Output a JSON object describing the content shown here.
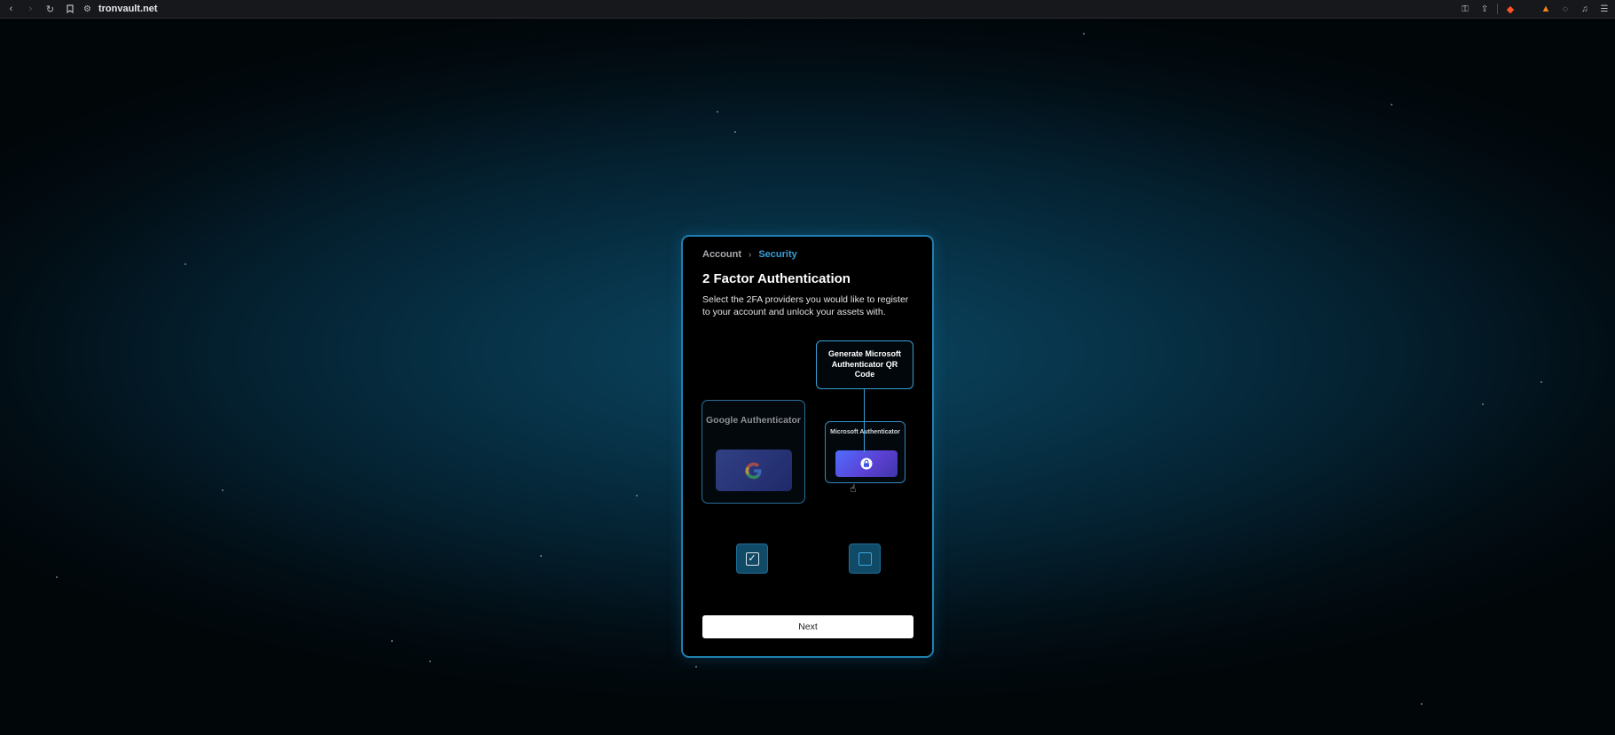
{
  "browser": {
    "url": "tronvault.net",
    "icons": [
      "back-icon",
      "forward-icon",
      "reload-icon",
      "bookmark-icon",
      "site-settings-icon",
      "key-icon",
      "share-icon",
      "brave-shield-icon",
      "metamask-icon",
      "chat-icon",
      "music-icon",
      "menu-icon"
    ]
  },
  "breadcrumb": {
    "items": [
      "Account",
      "Security"
    ],
    "separator": "›"
  },
  "page": {
    "title": "2 Factor Authentication",
    "description": "Select the 2FA providers you would like to register to your account and unlock your assets with."
  },
  "providers": [
    {
      "name": "Google Authenticator",
      "checked": true
    },
    {
      "name": "Microsoft Authenticator",
      "checked": false
    }
  ],
  "callout": "Generate Microsoft Authenticator QR Code",
  "next_label": "Next",
  "colors": {
    "accent": "#3a9fd6",
    "card_border": "#1f7fb0",
    "checkbox_bg": "#114a67",
    "background": "#04202f"
  }
}
